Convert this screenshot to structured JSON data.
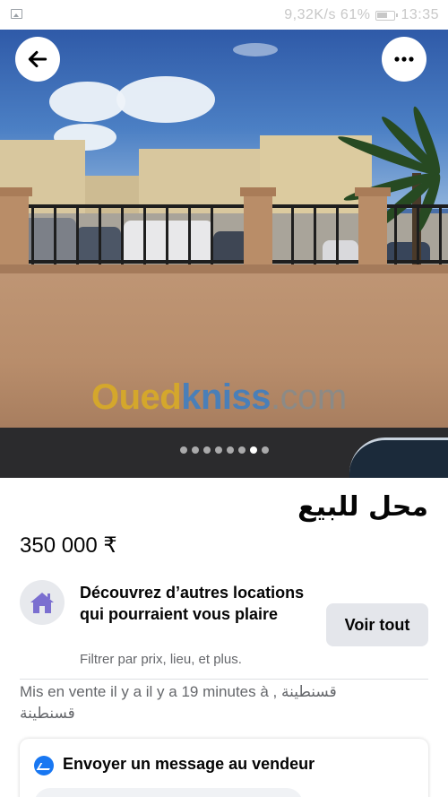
{
  "status_bar": {
    "right_text": "9,32K/s  61%",
    "time": "13:35"
  },
  "photo": {
    "watermark_oued": "Oued",
    "watermark_kniss": "kniss",
    "watermark_com": ".com",
    "page_count": 8,
    "current_page": 7
  },
  "listing": {
    "title": "محل للبيع",
    "price": "350 000 ₹"
  },
  "suggestion": {
    "title": "Découvrez d’autres locations qui pourraient vous plaire",
    "subtitle": "Filtrer par prix, lieu, et plus.",
    "button_label": "Voir tout"
  },
  "listed_info": "Mis en vente il y a il y a 19 minutes à قسنطينة , قسنطينة",
  "message_card": {
    "title": "Envoyer un message au vendeur"
  },
  "icons": {
    "back": "arrow-left-icon",
    "more": "more-horizontal-icon",
    "house": "house-icon",
    "messenger": "messenger-icon"
  },
  "colors": {
    "accent": "#1877f2",
    "button_bg": "#e4e6eb",
    "house_icon": "#7b6fd0"
  }
}
